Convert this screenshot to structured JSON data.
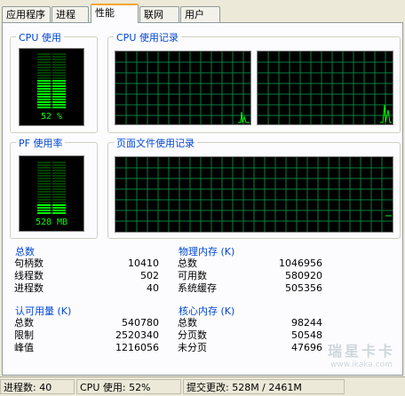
{
  "tabs": [
    "应用程序",
    "进程",
    "性能",
    "联网",
    "用户"
  ],
  "active_tab": "性能",
  "groups": {
    "cpu_usage": {
      "title": "CPU 使用",
      "meter_text": "52 %",
      "level": 0.52
    },
    "cpu_history": {
      "title": "CPU 使用记录"
    },
    "pf_usage": {
      "title": "PF 使用率",
      "meter_text": "528 MB",
      "level": 0.21
    },
    "pf_history": {
      "title": "页面文件使用记录"
    }
  },
  "totals": {
    "title": "总数",
    "rows": [
      {
        "label": "句柄数",
        "value": "10410"
      },
      {
        "label": "线程数",
        "value": "502"
      },
      {
        "label": "进程数",
        "value": "40"
      }
    ]
  },
  "physical_memory": {
    "title": "物理内存 (K)",
    "rows": [
      {
        "label": "总数",
        "value": "1046956"
      },
      {
        "label": "可用数",
        "value": "580920"
      },
      {
        "label": "系统缓存",
        "value": "505356"
      }
    ]
  },
  "commit_charge": {
    "title": "认可用量 (K)",
    "rows": [
      {
        "label": "总数",
        "value": "540780"
      },
      {
        "label": "限制",
        "value": "2520340"
      },
      {
        "label": "峰值",
        "value": "1216056"
      }
    ]
  },
  "kernel_memory": {
    "title": "核心内存 (K)",
    "rows": [
      {
        "label": "总数",
        "value": "98244"
      },
      {
        "label": "分页数",
        "value": "50548"
      },
      {
        "label": "未分页",
        "value": "47696"
      }
    ]
  },
  "statusbar": {
    "processes": "进程数: 40",
    "cpu": "CPU 使用: 52%",
    "commit": "提交更改: 528M / 2461M"
  },
  "watermark": {
    "text": "瑞星卡卡",
    "url": "www.ikaka.com"
  },
  "colors": {
    "grid": "#008040",
    "line": "#00ff00",
    "meter_off": "#004000",
    "meter_on": "#00ff00",
    "group_title": "#0046d5"
  }
}
